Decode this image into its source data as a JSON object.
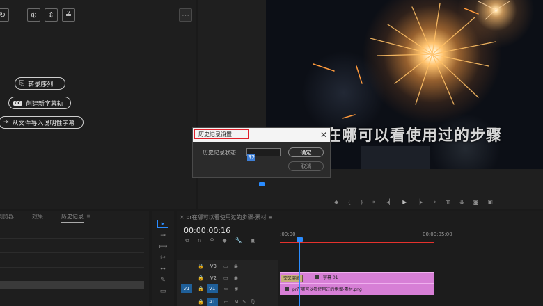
{
  "toolbar": {
    "icons": [
      "refresh-icon",
      "add-icon",
      "align-center-icon",
      "split-icon",
      "more-icon"
    ]
  },
  "captions": {
    "transcribe_label": "转录序列",
    "create_caption_label": "创建新字幕轨",
    "import_file_label": "从文件导入说明性字幕"
  },
  "video": {
    "overlay_text": "在哪可以看使用过的步骤"
  },
  "dialog": {
    "title": "历史记录设置",
    "field_label": "历史记录状态:",
    "field_value": "32",
    "ok_label": "确定",
    "cancel_label": "取消"
  },
  "history_panel": {
    "tabs": [
      "浏览器",
      "效果",
      "历史记录"
    ]
  },
  "timeline": {
    "title": "pr在哪可以看使用过的步骤-素材",
    "timecode": "00:00:00:16",
    "ruler_start": ":00:00",
    "ruler_mark": "00:00:05:00",
    "tracks": {
      "v3": "V3",
      "v2": "V2",
      "v1_source": "V1",
      "v1": "V1",
      "a1": "A1"
    },
    "clip_v2_fx": "交叉溶解",
    "clip_v2_title": "字幕 01",
    "clip_v1_name": "pr在哪可以看使用过的步骤-素材.png"
  },
  "colors": {
    "accent_blue": "#2a8cff",
    "dialog_highlight": "#e0202a",
    "clip_pink": "#d77fd6",
    "playhead_red": "#e5322d"
  }
}
